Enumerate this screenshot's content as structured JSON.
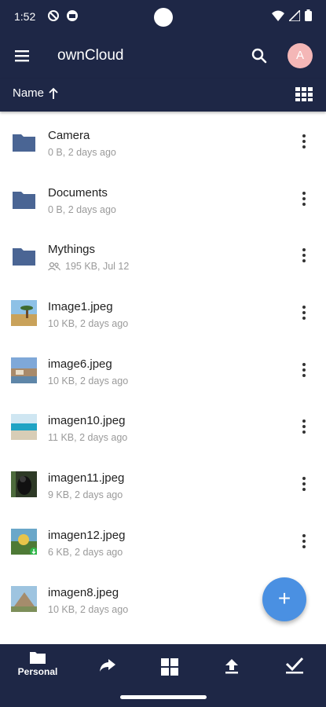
{
  "status": {
    "time": "1:52"
  },
  "toolbar": {
    "title": "ownCloud",
    "avatar_initial": "A"
  },
  "sort": {
    "label": "Name"
  },
  "files": [
    {
      "name": "Camera",
      "meta": "0 B, 2 days ago",
      "type": "folder"
    },
    {
      "name": "Documents",
      "meta": "0 B, 2 days ago",
      "type": "folder"
    },
    {
      "name": "Mythings",
      "meta": "195 KB, Jul 12",
      "type": "folder",
      "shared": true
    },
    {
      "name": "Image1.jpeg",
      "meta": "10 KB, 2 days ago",
      "type": "image"
    },
    {
      "name": "image6.jpeg",
      "meta": "10 KB, 2 days ago",
      "type": "image"
    },
    {
      "name": "imagen10.jpeg",
      "meta": "11 KB, 2 days ago",
      "type": "image"
    },
    {
      "name": "imagen11.jpeg",
      "meta": "9 KB, 2 days ago",
      "type": "image"
    },
    {
      "name": "imagen12.jpeg",
      "meta": "6 KB, 2 days ago",
      "type": "image",
      "downloaded": true
    },
    {
      "name": "imagen8.jpeg",
      "meta": "10 KB, 2 days ago",
      "type": "image"
    }
  ],
  "bottom_nav": {
    "personal_label": "Personal"
  },
  "colors": {
    "bar": "#1e2746",
    "folder": "#4a6594",
    "fab": "#4a90e2",
    "avatar": "#f4b7b7"
  }
}
